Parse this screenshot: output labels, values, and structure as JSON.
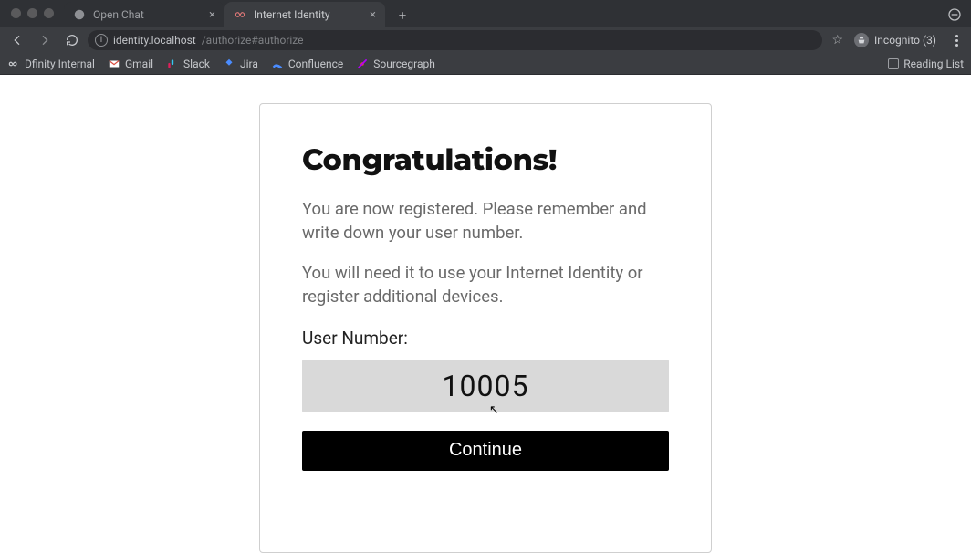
{
  "tabs": {
    "inactive": {
      "label": "Open Chat"
    },
    "active": {
      "label": "Internet Identity"
    }
  },
  "url": {
    "host": "identity.localhost",
    "path": "/authorize#authorize"
  },
  "incognito": {
    "label": "Incognito (3)"
  },
  "bookmarks": {
    "items": [
      {
        "label": "Dfinity Internal",
        "icon": "infinity"
      },
      {
        "label": "Gmail",
        "icon": "gmail"
      },
      {
        "label": "Slack",
        "icon": "slack"
      },
      {
        "label": "Jira",
        "icon": "jira"
      },
      {
        "label": "Confluence",
        "icon": "confluence"
      },
      {
        "label": "Sourcegraph",
        "icon": "sourcegraph"
      }
    ],
    "reading_list": "Reading List"
  },
  "card": {
    "title": "Congratulations!",
    "p1": "You are now registered. Please remember and write down your user number.",
    "p2": "You will need it to use your Internet Identity or register additional devices.",
    "user_number_label": "User Number:",
    "user_number": "10005",
    "continue": "Continue"
  }
}
